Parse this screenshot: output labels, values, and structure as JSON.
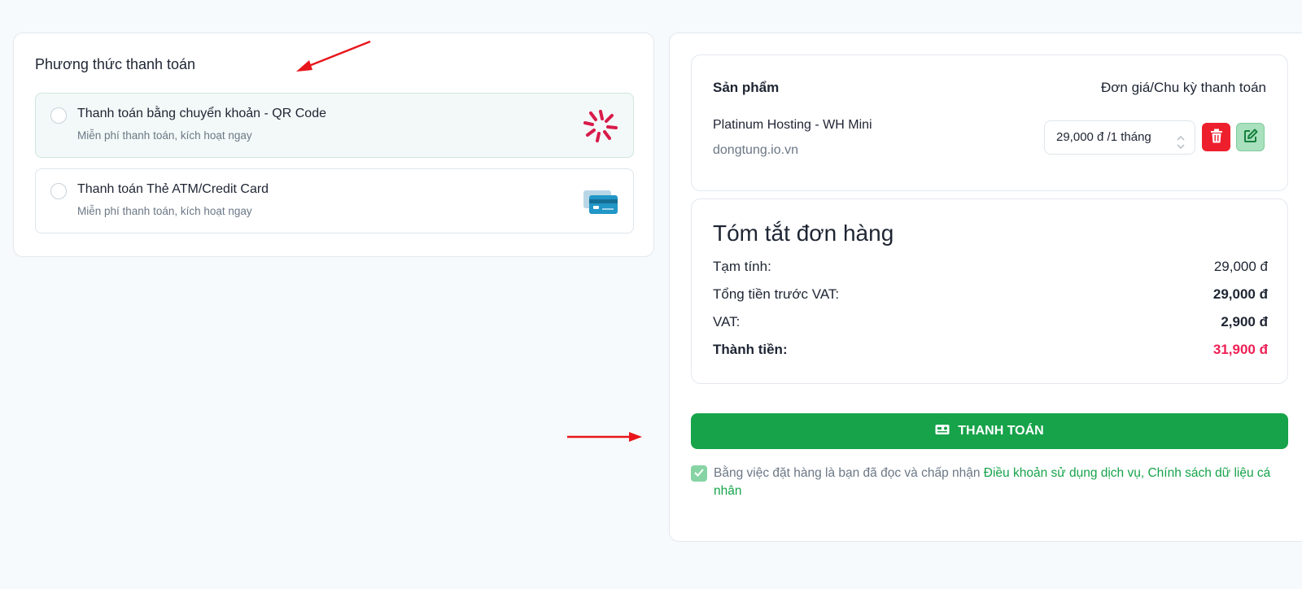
{
  "payment": {
    "title": "Phương thức thanh toán",
    "options": [
      {
        "title": "Thanh toán bằng chuyển khoản - QR Code",
        "subtitle": "Miễn phí thanh toán, kích hoạt ngay",
        "icon": "napas-icon",
        "selected": true
      },
      {
        "title": "Thanh toán Thẻ ATM/Credit Card",
        "subtitle": "Miễn phí thanh toán, kích hoạt ngay",
        "icon": "credit-card-icon",
        "selected": false
      }
    ]
  },
  "product": {
    "header_left": "Sản phẩm",
    "header_right": "Đơn giá/Chu kỳ thanh toán",
    "name": "Platinum Hosting - WH Mini",
    "domain": "dongtung.io.vn",
    "cycle": "29,000 đ /1 tháng"
  },
  "summary": {
    "title": "Tóm tắt đơn hàng",
    "rows": [
      {
        "label": "Tạm tính:",
        "value": "29,000 đ"
      },
      {
        "label": "Tổng tiền trước VAT:",
        "value": "29,000 đ"
      },
      {
        "label": "VAT:",
        "value": "2,900 đ"
      },
      {
        "label": "Thành tiền:",
        "value": "31,900 đ"
      }
    ]
  },
  "checkout": {
    "pay_label": "THANH TOÁN",
    "agree_prefix": "Bằng việc đặt hàng là bạn đã đọc và chấp nhận ",
    "agree_link": "Điều khoản sử dụng dịch vụ, Chính sách dữ liệu cá nhân"
  },
  "colors": {
    "accent": "#16a34a",
    "danger": "#ee1f2c",
    "total": "#ee1f55",
    "annotation": "#e8161b"
  }
}
